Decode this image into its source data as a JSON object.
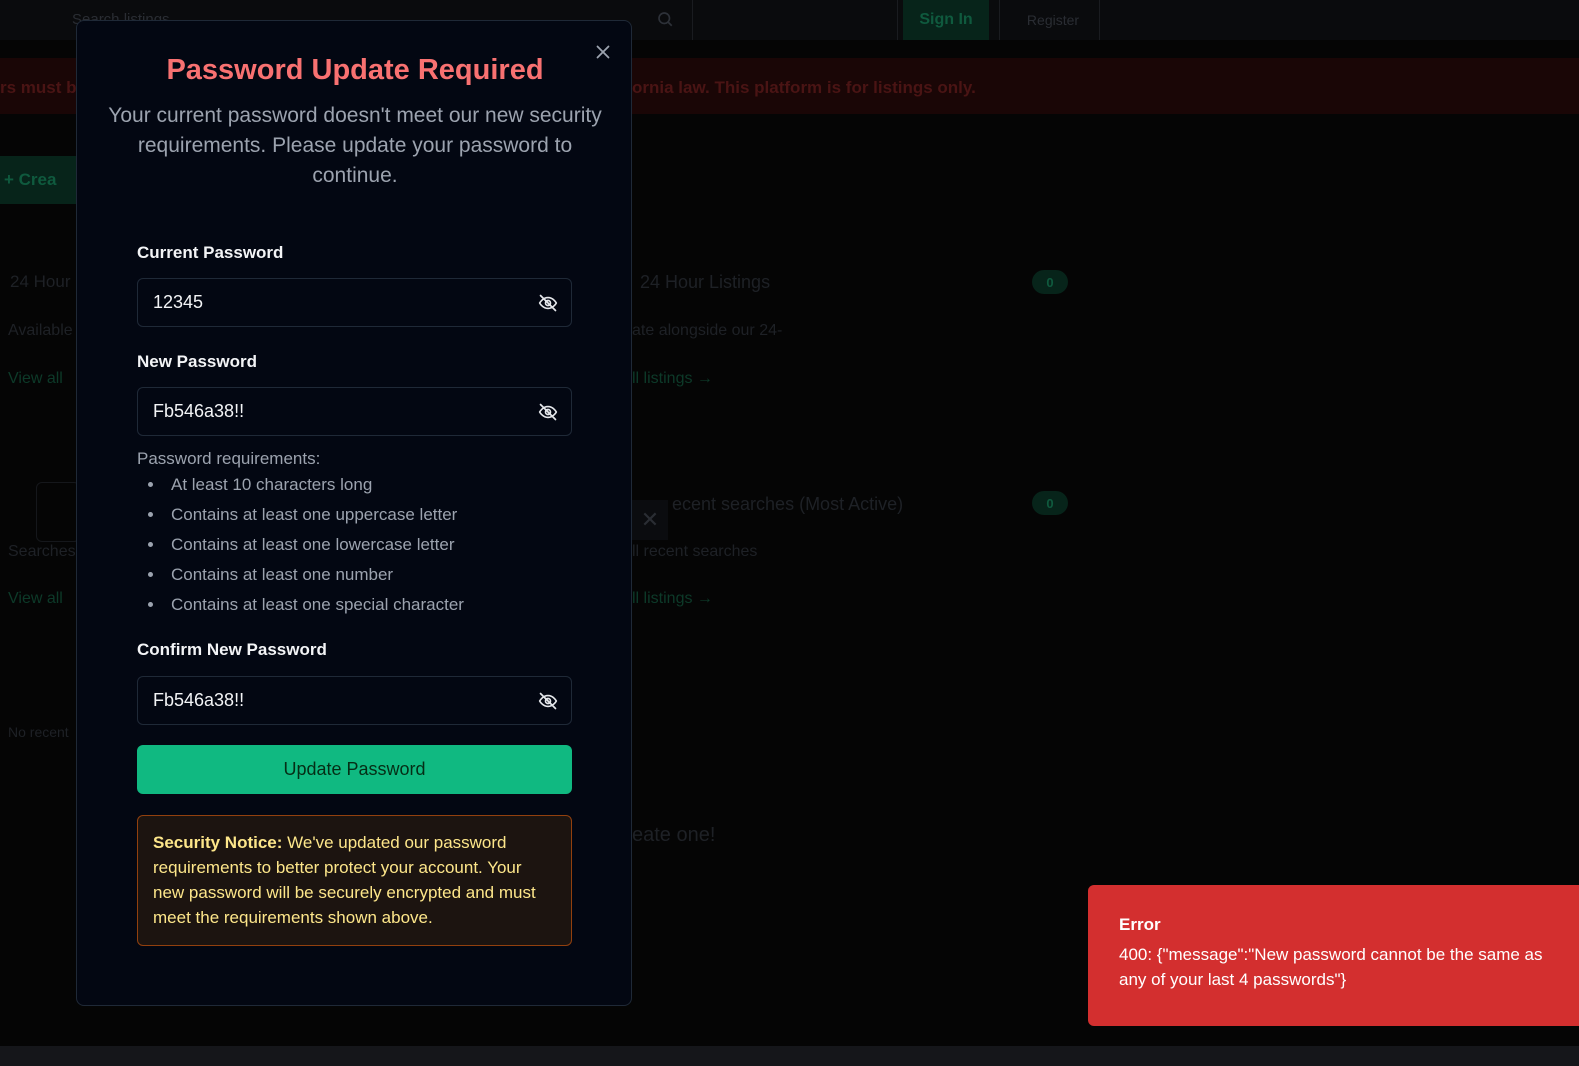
{
  "background": {
    "search_placeholder": "Search listings...",
    "sign_in_label": "Sign In",
    "register_label": "Register",
    "banner_text_left": "rs must b",
    "banner_text_right": "ornia law. This platform is for listings only.",
    "create_label": "+   Crea",
    "section1": {
      "title": "24 Hour Listings",
      "title_right": "24 Hour Listings",
      "badge": "0",
      "desc_left": "Available",
      "desc_right": "ate alongside our 24-",
      "link_left": "View all",
      "link_right": "ll listings →"
    },
    "section2": {
      "title_right": "ecent searches (Most Active)",
      "badge": "0",
      "desc_left": "Searches",
      "desc_right": "ll recent searches",
      "link_left": "View all",
      "link_right": "ll listings →"
    },
    "misc_left": "No recent",
    "cta_right": "eate one!"
  },
  "modal": {
    "title": "Password Update Required",
    "subtitle": "Your current password doesn't meet our new security requirements. Please update your password to continue.",
    "current_label": "Current Password",
    "current_value": "12345",
    "new_label": "New Password",
    "new_value": "Fb546a38!!",
    "requirements_title": "Password requirements:",
    "requirements": [
      "At least 10 characters long",
      "Contains at least one uppercase letter",
      "Contains at least one lowercase letter",
      "Contains at least one number",
      "Contains at least one special character"
    ],
    "confirm_label": "Confirm New Password",
    "confirm_value": "Fb546a38!!",
    "submit_label": "Update Password",
    "notice_heading": "Security Notice:",
    "notice_body": " We've updated our password requirements to better protect your account. Your new password will be securely encrypted and must meet the requirements shown above."
  },
  "toast": {
    "title": "Error",
    "message": "400: {\"message\":\"New password cannot be the same as any of your last 4 passwords\"}"
  },
  "colors": {
    "accent_green": "#10b981",
    "title_red": "#f87171",
    "toast_red": "#d32f2f",
    "notice_text": "#fde68a"
  },
  "icons": {
    "close": "close-icon",
    "password_toggle": "eye-off-icon",
    "search": "search-icon"
  }
}
